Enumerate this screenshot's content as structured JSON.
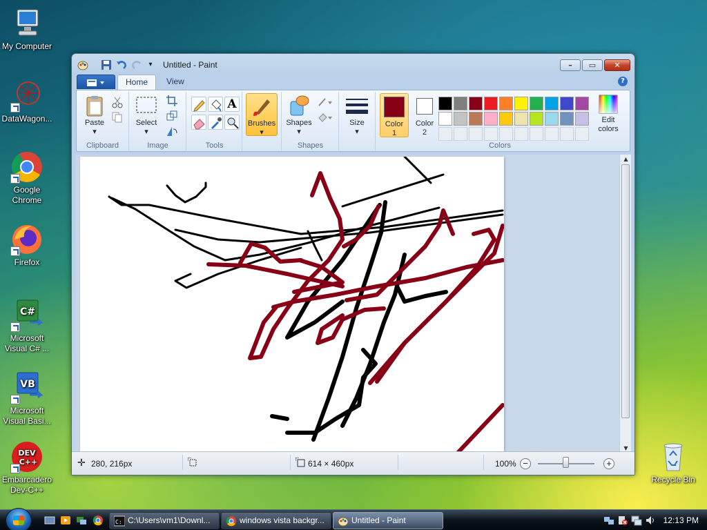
{
  "desktop": {
    "icons": [
      {
        "label": "My Computer"
      },
      {
        "label": "DataWagon..."
      },
      {
        "label": "Google Chrome"
      },
      {
        "label": "Firefox"
      },
      {
        "label": "Microsoft Visual C# ..."
      },
      {
        "label": "Microsoft Visual Basi..."
      },
      {
        "label": "Embarcadero Dev-C++"
      },
      {
        "label": "Recycle Bin"
      }
    ]
  },
  "window": {
    "title": "Untitled - Paint",
    "tabs": [
      {
        "label": "Home"
      },
      {
        "label": "View"
      }
    ],
    "ribbon": {
      "clipboard": {
        "group_label": "Clipboard",
        "paste_label": "Paste"
      },
      "image": {
        "group_label": "Image",
        "select_label": "Select"
      },
      "tools": {
        "group_label": "Tools"
      },
      "brushes": {
        "label": "Brushes"
      },
      "shapes": {
        "group_label": "Shapes",
        "shapes_label": "Shapes"
      },
      "size": {
        "label": "Size"
      },
      "colors": {
        "group_label": "Colors",
        "color1_label": "Color 1",
        "color1_number": "1",
        "color1_word": "Color",
        "color2_word": "Color",
        "color2_number": "2",
        "color1_value": "#880015",
        "color2_value": "#ffffff",
        "edit_colors_line1": "Edit",
        "edit_colors_line2": "colors",
        "palette_row1": [
          "#000000",
          "#7f7f7f",
          "#880015",
          "#ed1c24",
          "#ff7f27",
          "#fff200",
          "#22b14c",
          "#00a2e8",
          "#3f48cc",
          "#a349a4"
        ],
        "palette_row2": [
          "#ffffff",
          "#c3c3c3",
          "#b97a57",
          "#ffaec9",
          "#ffc90e",
          "#efe4b0",
          "#b5e61d",
          "#99d9ea",
          "#7092be",
          "#c8bfe7"
        ]
      }
    },
    "status": {
      "cursor_pos": "280, 216px",
      "canvas_size": "614 × 460px",
      "zoom": "100%",
      "zoom_level": 0.5
    }
  },
  "taskbar": {
    "tasks": [
      {
        "label": "C:\\Users\\vm1\\Downl..."
      },
      {
        "label": "windows vista backgr..."
      },
      {
        "label": "Untitled - Paint"
      }
    ],
    "clock": "12:13 PM"
  }
}
